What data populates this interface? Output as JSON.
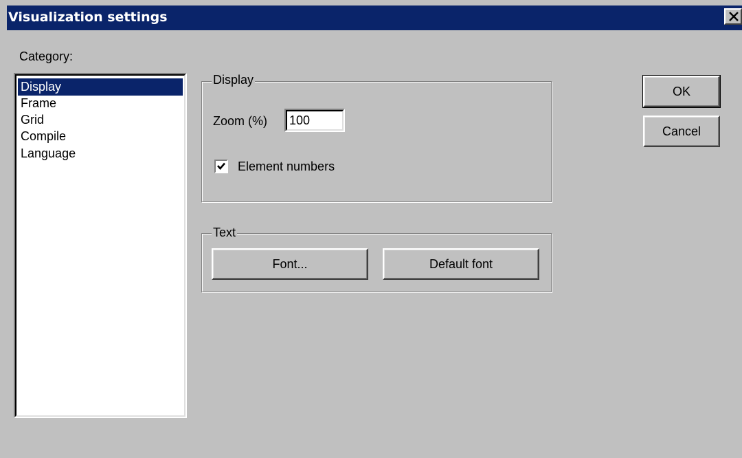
{
  "window": {
    "title": "Visualization settings",
    "close_glyph": "✕"
  },
  "category": {
    "label": "Category:",
    "items": [
      {
        "label": "Display",
        "selected": true
      },
      {
        "label": "Frame",
        "selected": false
      },
      {
        "label": "Grid",
        "selected": false
      },
      {
        "label": "Compile",
        "selected": false
      },
      {
        "label": "Language",
        "selected": false
      }
    ]
  },
  "display_group": {
    "legend": "Display",
    "zoom_label": "Zoom (%)",
    "zoom_value": "100",
    "element_numbers_label": "Element numbers",
    "element_numbers_checked": true
  },
  "text_group": {
    "legend": "Text",
    "font_button": "Font...",
    "default_font_button": "Default font"
  },
  "actions": {
    "ok": "OK",
    "cancel": "Cancel"
  },
  "colors": {
    "titlebar": "#0a246a",
    "dialog_bg": "#c0c0c0",
    "selection": "#0a246a"
  }
}
